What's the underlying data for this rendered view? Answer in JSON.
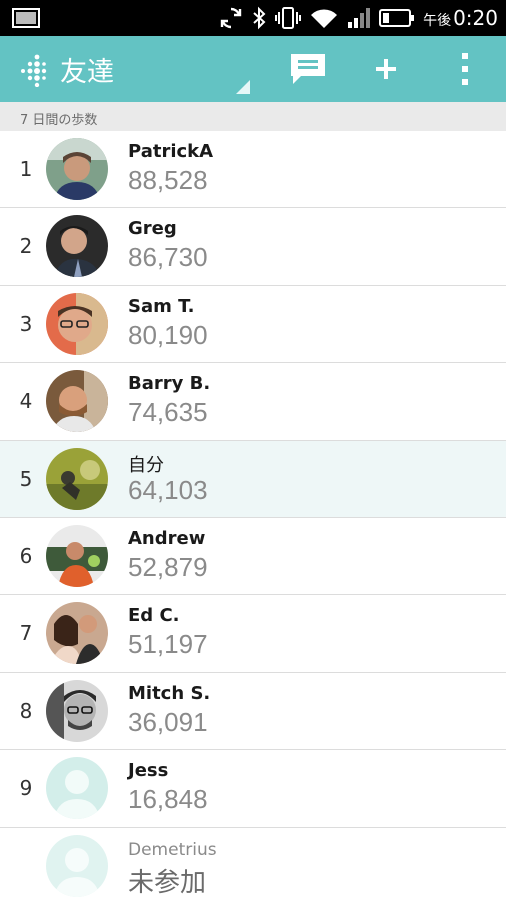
{
  "status_bar": {
    "time_prefix": "午後",
    "time": "0:20"
  },
  "action_bar": {
    "title": "友達",
    "icons": [
      "fitbit-logo-icon",
      "message-icon",
      "add-icon",
      "overflow-menu-icon"
    ]
  },
  "section_header": "7 日間の歩数",
  "leaderboard": [
    {
      "rank": "1",
      "name": "PatrickA",
      "steps": "88,528"
    },
    {
      "rank": "2",
      "name": "Greg",
      "steps": "86,730"
    },
    {
      "rank": "3",
      "name": "Sam T.",
      "steps": "80,190"
    },
    {
      "rank": "4",
      "name": "Barry B.",
      "steps": "74,635"
    },
    {
      "rank": "5",
      "name": "自分",
      "steps": "64,103"
    },
    {
      "rank": "6",
      "name": "Andrew",
      "steps": "52,879"
    },
    {
      "rank": "7",
      "name": "Ed C.",
      "steps": "51,197"
    },
    {
      "rank": "8",
      "name": "Mitch S.",
      "steps": "36,091"
    },
    {
      "rank": "9",
      "name": "Jess",
      "steps": "16,848"
    }
  ],
  "pending": {
    "name": "Demetrius",
    "status": "未参加"
  },
  "colors": {
    "accent": "#63c3c3",
    "self_row": "#eef7f7",
    "steps_text": "#8a8a8a"
  }
}
